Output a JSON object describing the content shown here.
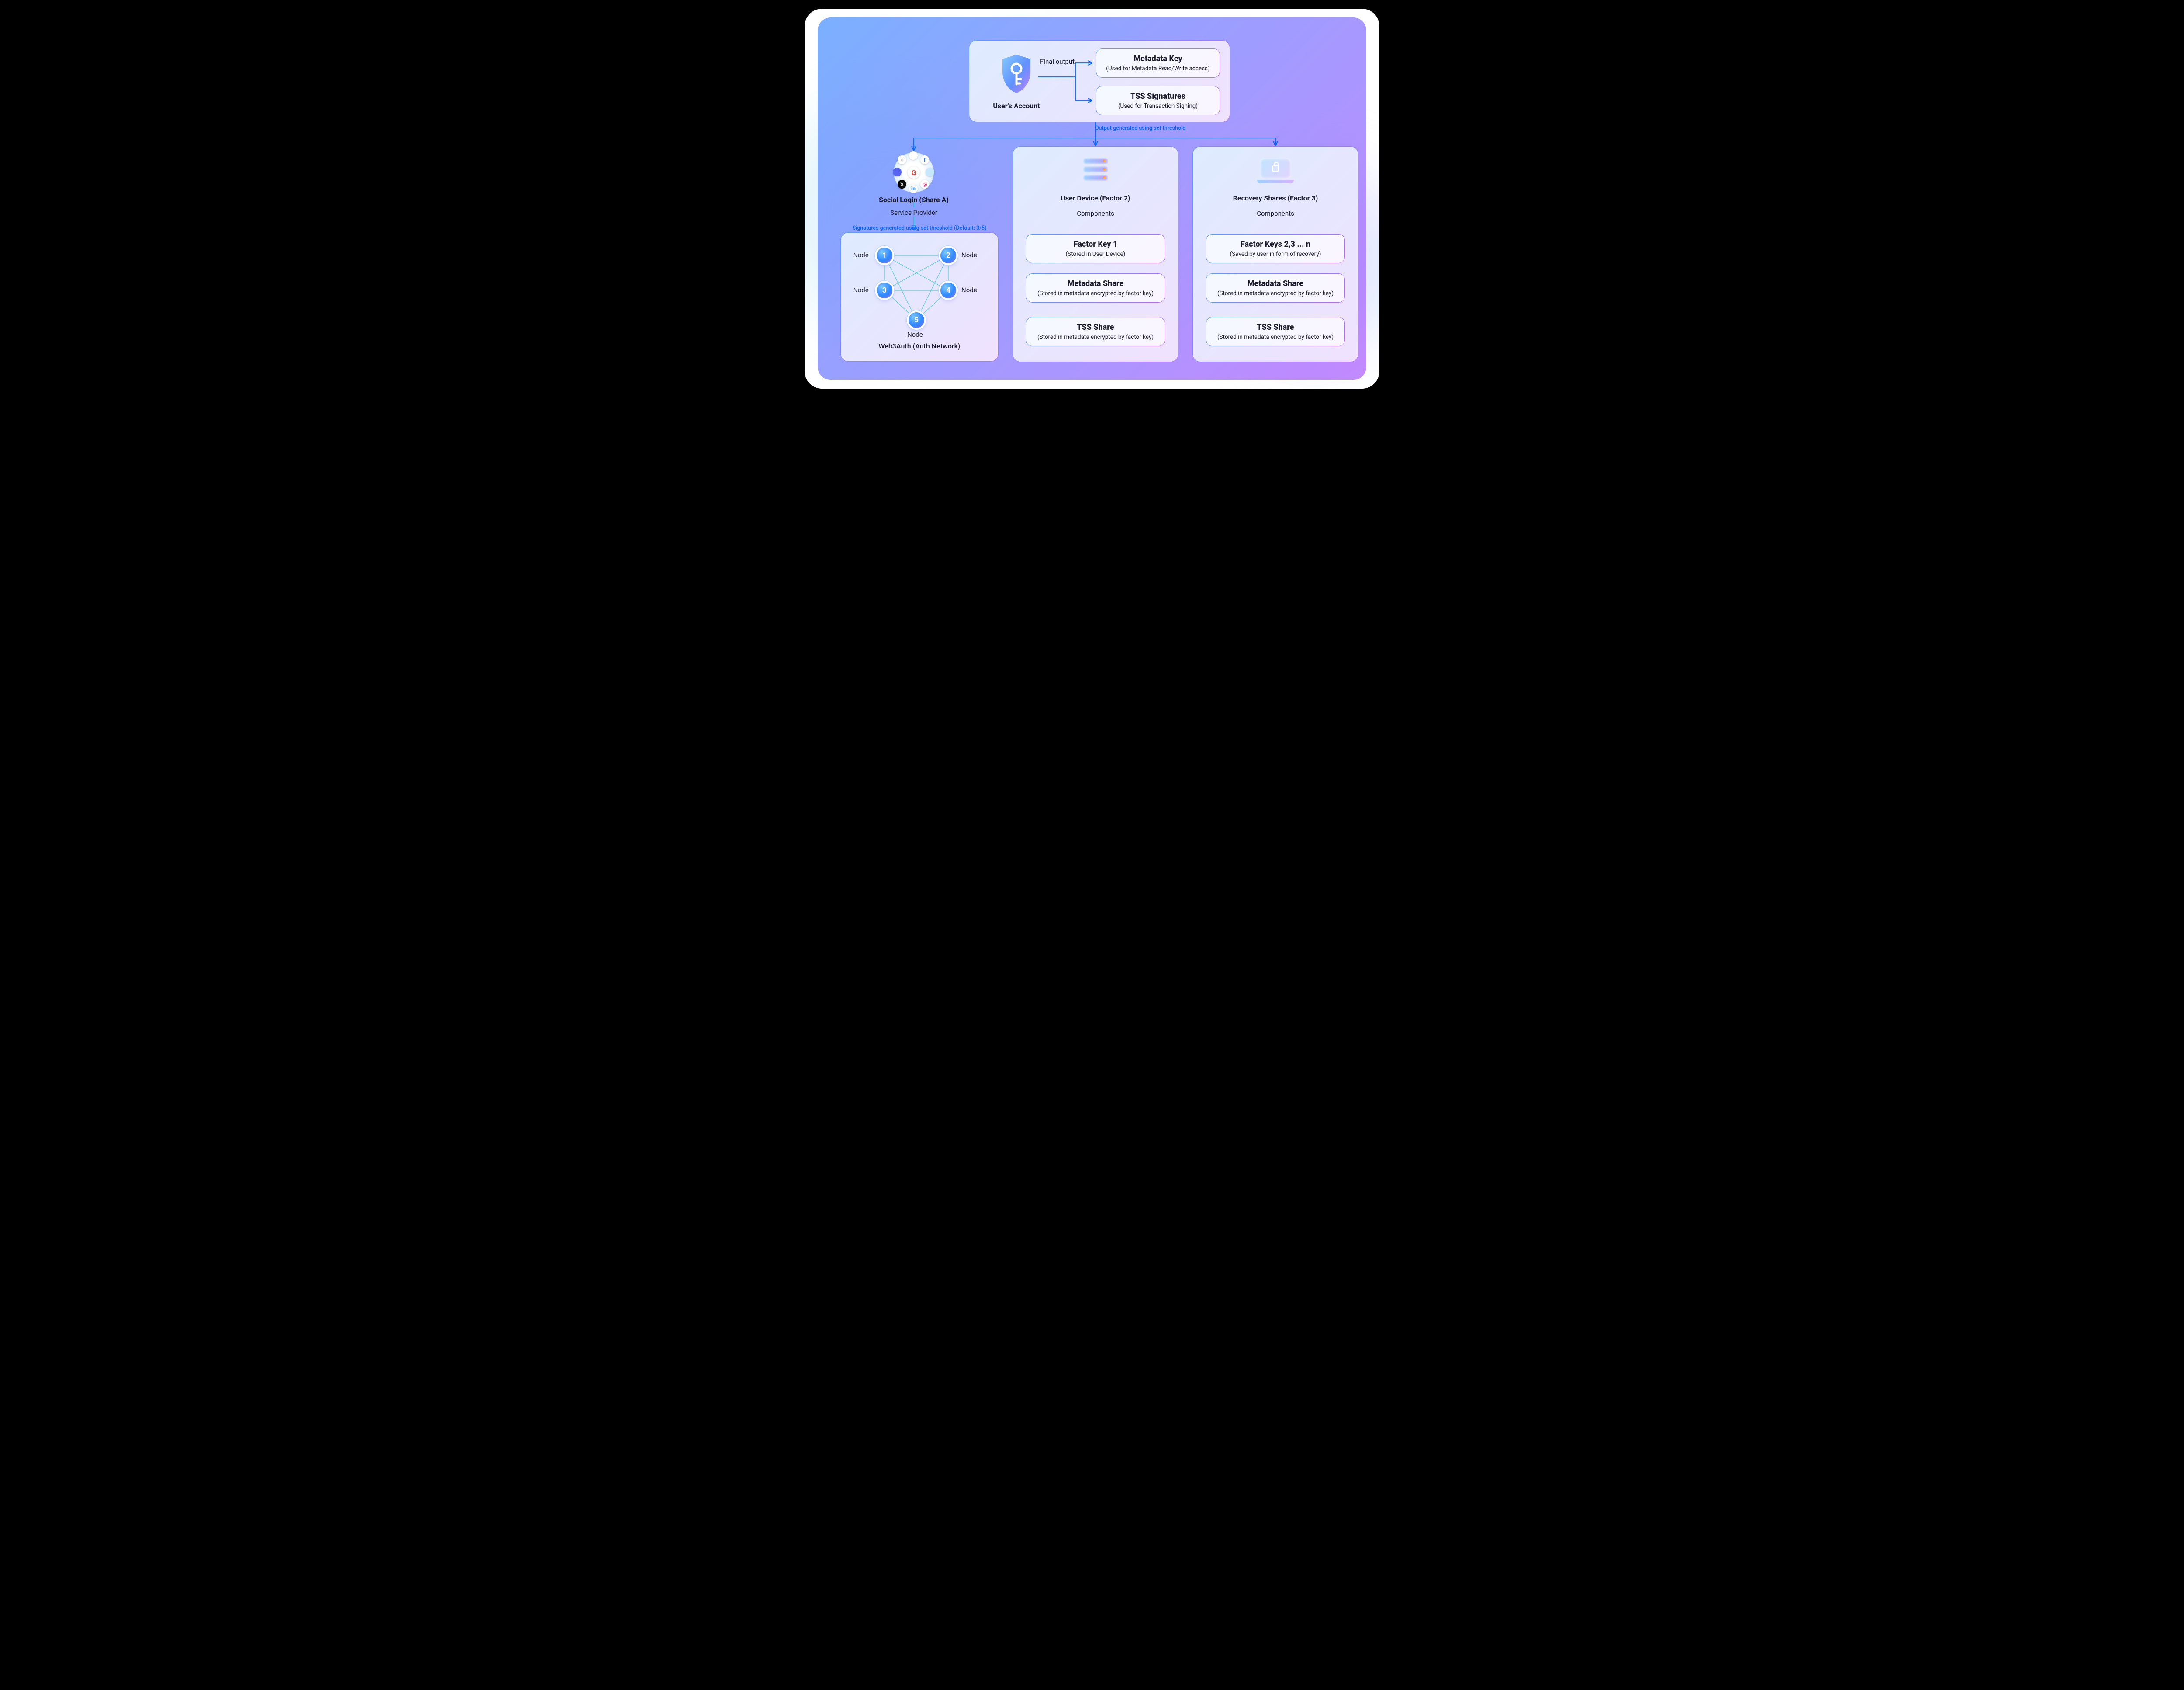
{
  "top": {
    "user_account": "User's Account",
    "final_output": "Final output",
    "metadata_key": {
      "title": "Metadata Key",
      "sub": "(Used for Metadata Read/Write access)"
    },
    "tss_sig": {
      "title": "TSS Signatures",
      "sub": "(Used for Transaction Signing)"
    }
  },
  "caption_output": "Output generated using set threshold",
  "col1": {
    "title": "Social Login (Share A)",
    "service_provider": "Service Provider",
    "sig_caption": "Signatures generated using set threshold (Default: 3/5)",
    "node_label": "Node",
    "network": "Web3Auth (Auth Network)",
    "nodes": [
      "1",
      "2",
      "3",
      "4",
      "5"
    ]
  },
  "col2": {
    "title": "User Device (Factor 2)",
    "components": "Components",
    "b1": {
      "title": "Factor Key 1",
      "sub": "(Stored in User Device)"
    },
    "b2": {
      "title": "Metadata Share",
      "sub": "(Stored in metadata encrypted by factor key)"
    },
    "b3": {
      "title": "TSS Share",
      "sub": "(Stored in metadata encrypted by factor key)"
    }
  },
  "col3": {
    "title": "Recovery Shares (Factor 3)",
    "components": "Components",
    "b1": {
      "title": "Factor Keys 2,3 ... n",
      "sub": "(Saved by user in form of recovery)"
    },
    "b2": {
      "title": "Metadata Share",
      "sub": "(Stored in metadata encrypted by factor key)"
    },
    "b3": {
      "title": "TSS Share",
      "sub": "(Stored in metadata encrypted by factor key)"
    }
  }
}
